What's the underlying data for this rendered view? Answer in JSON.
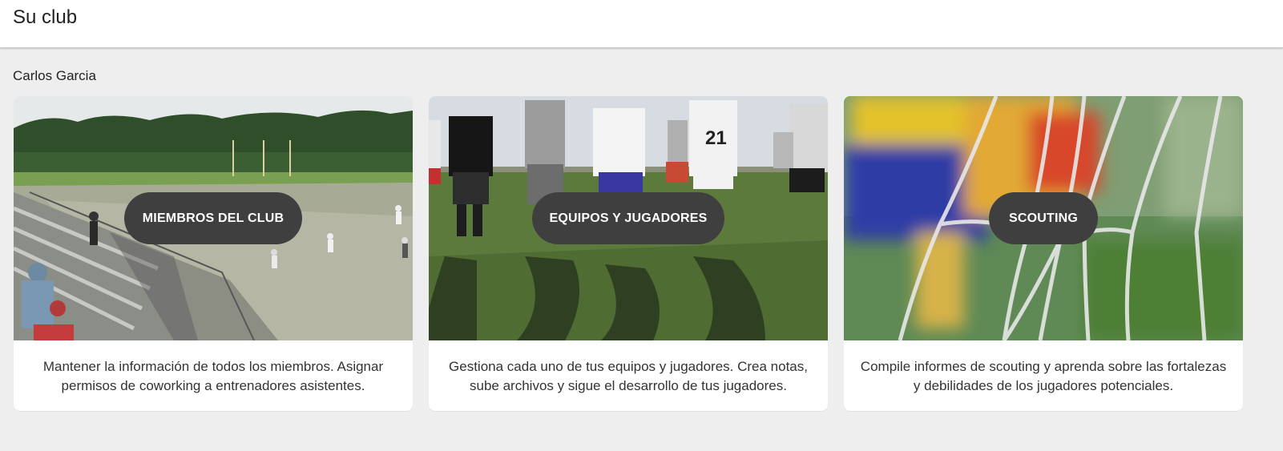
{
  "header": {
    "title": "Su club"
  },
  "owner": {
    "name": "Carlos Garcia"
  },
  "cards": [
    {
      "button_label": "MIEMBROS DEL CLUB",
      "description": "Mantener la información de todos los miembros. Asignar permisos de coworking a entrenadores asistentes."
    },
    {
      "button_label": "EQUIPOS Y JUGADORES",
      "description": "Gestiona cada uno de tus equipos y jugadores. Crea notas, sube archivos y sigue el desarrollo de tus jugadores."
    },
    {
      "button_label": "SCOUTING",
      "description": "Compile informes de scouting y aprenda sobre las fortalezas y debilidades de los jugadores potenciales."
    }
  ],
  "colors": {
    "background": "#eeeeee",
    "card": "#ffffff",
    "button": "#3f3f3f",
    "button_text": "#ffffff"
  }
}
